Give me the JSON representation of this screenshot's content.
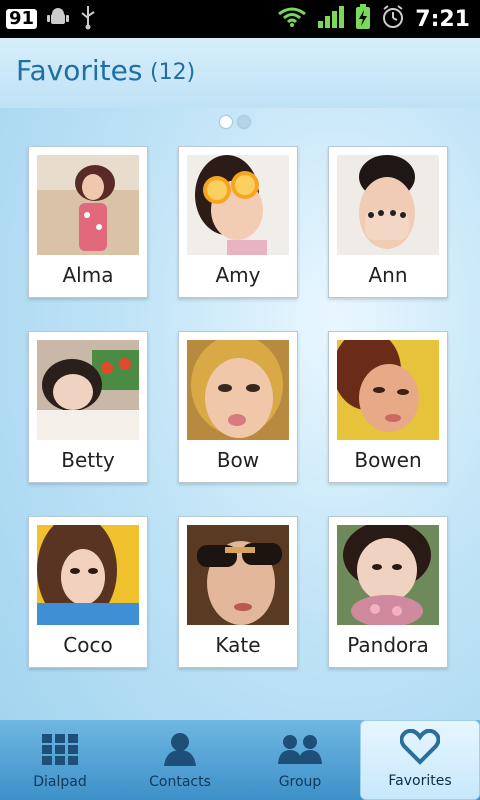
{
  "status_bar": {
    "notification_badge": "91",
    "time": "7:21",
    "icons": [
      "android-debug-icon",
      "usb-icon",
      "wifi-icon",
      "signal-icon",
      "battery-charging-icon",
      "alarm-icon"
    ]
  },
  "header": {
    "title": "Favorites",
    "count": "(12)"
  },
  "favorites": [
    {
      "name": "Alma"
    },
    {
      "name": "Amy"
    },
    {
      "name": "Ann"
    },
    {
      "name": "Betty"
    },
    {
      "name": "Bow"
    },
    {
      "name": "Bowen"
    },
    {
      "name": "Coco"
    },
    {
      "name": "Kate"
    },
    {
      "name": "Pandora"
    }
  ],
  "bottom_nav": {
    "items": [
      {
        "label": "Dialpad",
        "icon": "dialpad-icon"
      },
      {
        "label": "Contacts",
        "icon": "contacts-icon"
      },
      {
        "label": "Group",
        "icon": "group-icon"
      },
      {
        "label": "Favorites",
        "icon": "heart-icon"
      }
    ],
    "active": "Favorites"
  },
  "colors": {
    "accent": "#1e6fa4",
    "nav": "#4a9ed3"
  }
}
